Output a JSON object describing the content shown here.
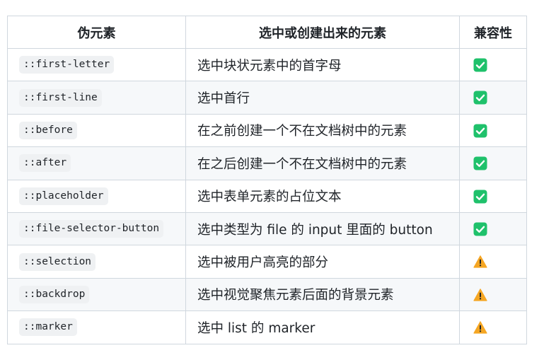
{
  "table": {
    "headers": [
      "伪元素",
      "选中或创建出来的元素",
      "兼容性"
    ],
    "rows": [
      {
        "pseudo": "::first-letter",
        "desc": "选中块状元素中的首字母",
        "compat": "check"
      },
      {
        "pseudo": "::first-line",
        "desc": "选中首行",
        "compat": "check"
      },
      {
        "pseudo": "::before",
        "desc": "在之前创建一个不在文档树中的元素",
        "compat": "check"
      },
      {
        "pseudo": "::after",
        "desc": "在之后创建一个不在文档树中的元素",
        "compat": "check"
      },
      {
        "pseudo": "::placeholder",
        "desc": "选中表单元素的占位文本",
        "compat": "check"
      },
      {
        "pseudo": "::file-selector-button",
        "desc": "选中类型为 file 的 input 里面的 button",
        "compat": "check"
      },
      {
        "pseudo": "::selection",
        "desc": "选中被用户高亮的部分",
        "compat": "warning"
      },
      {
        "pseudo": "::backdrop",
        "desc": "选中视觉聚焦元素后面的背景元素",
        "compat": "warning"
      },
      {
        "pseudo": "::marker",
        "desc": "选中 list 的 marker",
        "compat": "warning"
      }
    ]
  },
  "icons": {
    "check": "check-mark-button-icon",
    "warning": "warning-icon"
  },
  "colors": {
    "check_green": "#1fc16b",
    "warning_orange": "#f5a623",
    "border": "#d0d7de",
    "stripe": "#f6f8fa",
    "code_bg": "#eff1f3"
  }
}
